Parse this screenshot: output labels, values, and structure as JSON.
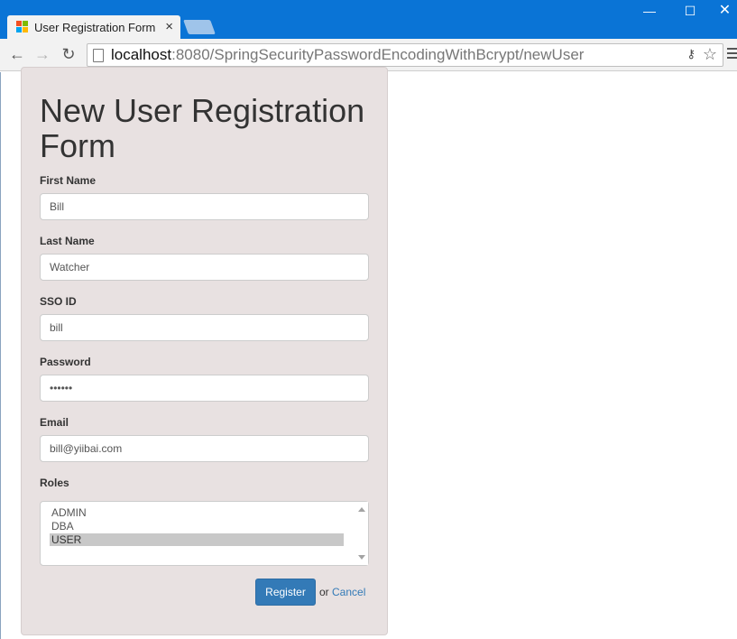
{
  "browser": {
    "tab_title": "User Registration Form",
    "tab_close": "×",
    "url_host": "localhost",
    "url_rest": ":8080/SpringSecurityPasswordEncodingWithBcrypt/newUser",
    "icons": {
      "back": "←",
      "forward": "→",
      "reload": "↻",
      "minimize": "—",
      "maximize": "☐",
      "close": "✕",
      "key": "⚷",
      "star": "☆"
    }
  },
  "form": {
    "title": "New User Registration Form",
    "fields": {
      "first_name": {
        "label": "First Name",
        "value": "Bill"
      },
      "last_name": {
        "label": "Last Name",
        "value": "Watcher"
      },
      "sso_id": {
        "label": "SSO ID",
        "value": "bill"
      },
      "password": {
        "label": "Password",
        "value": "••••••"
      },
      "email": {
        "label": "Email",
        "value": "bill@yiibai.com"
      }
    },
    "roles": {
      "label": "Roles",
      "options": [
        {
          "label": "ADMIN"
        },
        {
          "label": "DBA"
        },
        {
          "label": "USER"
        }
      ],
      "selected": "USER"
    },
    "register_label": "Register",
    "or_text": "or",
    "cancel_label": "Cancel"
  },
  "colors": {
    "titlebar": "#0a74d6",
    "panel": "#e8e1e1",
    "primary_button": "#337ab7",
    "link": "#337ab7"
  }
}
